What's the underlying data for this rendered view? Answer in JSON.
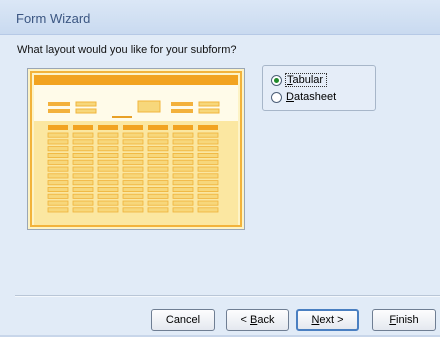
{
  "window": {
    "title": "Form Wizard"
  },
  "prompt": "What layout would you like for your subform?",
  "layout_options": [
    {
      "label": "Tabular",
      "mnemonic": "T",
      "rest": "abular",
      "selected": true
    },
    {
      "label": "Datasheet",
      "mnemonic": "D",
      "rest": "atasheet",
      "selected": false
    }
  ],
  "buttons": {
    "cancel": "Cancel",
    "back": "< Back",
    "back_pre": "< ",
    "back_mnemonic": "B",
    "back_rest": "ack",
    "next": "Next >",
    "next_mnemonic": "N",
    "next_rest": "ext >",
    "finish": "Finish",
    "finish_mnemonic": "F",
    "finish_rest": "inish"
  },
  "colors": {
    "accent": "#f2a51f",
    "header_bar": "#f2a320",
    "field_fill": "#f7d77b",
    "preview_bg": "#fdf3c6",
    "selected_radio": "#1f8a2a"
  }
}
